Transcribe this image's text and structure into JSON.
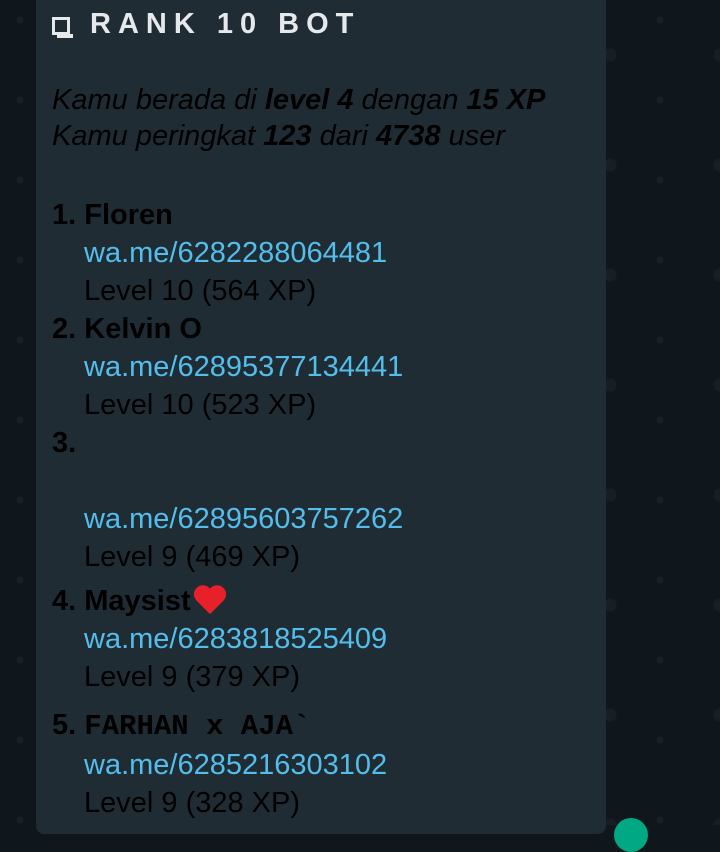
{
  "header": {
    "title": "RANK 10 BOT"
  },
  "intro": {
    "line1_prefix": "Kamu berada di ",
    "level_text": "level 4",
    "line1_mid": " dengan ",
    "xp_text": "15 XP",
    "line2_prefix": "Kamu peringkat ",
    "rank": "123",
    "line2_mid": " dari ",
    "total": "4738",
    "line2_suffix": " user"
  },
  "entries": [
    {
      "number": "1.",
      "name": "Floren",
      "link": "wa.me/6282288064481",
      "level": "Level 10 (564 XP)"
    },
    {
      "number": "2.",
      "name": "Kelvin O",
      "link": "wa.me/62895377134441",
      "level": "Level 10 (523 XP)"
    },
    {
      "number": "3.",
      "name": "",
      "link": "wa.me/62895603757262",
      "level": "Level 9 (469 XP)"
    },
    {
      "number": "4.",
      "name": "Maysist",
      "link": "wa.me/6283818525409",
      "level": "Level 9 (379 XP)"
    },
    {
      "number": "5.",
      "name": "FARHAN x AJA`",
      "link": "wa.me/6285216303102",
      "level": "Level 9 (328 XP)"
    }
  ],
  "icons": {
    "checkbox": "checkbox-icon",
    "heart": "red-heart-icon"
  },
  "colors": {
    "bubble": "#202c33",
    "text": "#e6e9eb",
    "link": "#53bdeb",
    "background": "#0f171c"
  }
}
